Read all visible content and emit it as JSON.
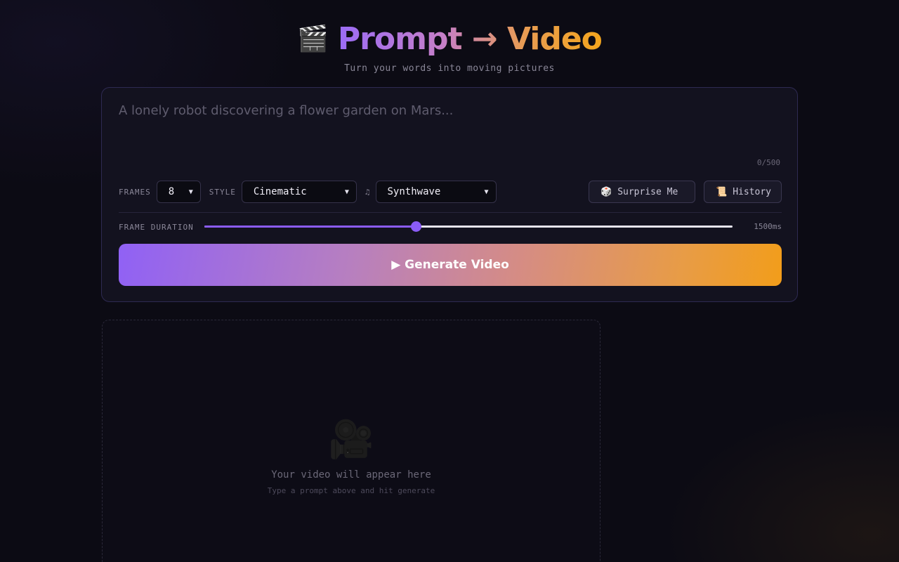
{
  "header": {
    "clapper_icon": "🎬",
    "title": "Prompt → Video",
    "subtitle": "Turn your words into moving pictures"
  },
  "prompt": {
    "placeholder": "A lonely robot discovering a flower garden on Mars...",
    "value": "",
    "char_count": "0/500"
  },
  "controls": {
    "frames_label": "FRAMES",
    "frames_value": "8",
    "style_label": "STYLE",
    "style_value": "Cinematic",
    "music_icon": "♫",
    "music_value": "Synthwave",
    "surprise_icon": "🎲",
    "surprise_label": "Surprise Me",
    "history_icon": "📜",
    "history_label": "History"
  },
  "duration": {
    "label": "FRAME DURATION",
    "value_text": "1500ms",
    "slider_fraction": 0.4
  },
  "generate": {
    "label": "▶ Generate Video"
  },
  "preview": {
    "camera_icon": "🎥",
    "title": "Your video will appear here",
    "subtitle": "Type a prompt above and hit generate"
  },
  "colors": {
    "accent_purple": "#8b5cf6",
    "accent_orange": "#f29d1a",
    "background": "#0c0b14"
  }
}
